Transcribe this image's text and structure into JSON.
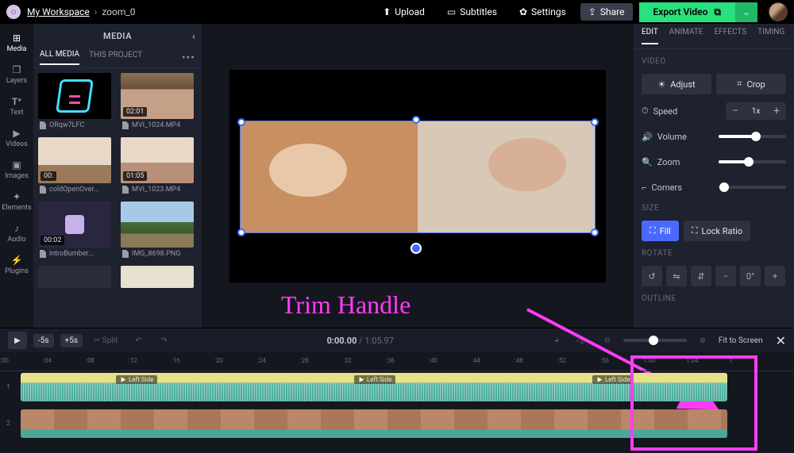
{
  "topbar": {
    "workspace": "My Workspace",
    "project": "zoom_0",
    "upload": "Upload",
    "subtitles": "Subtitles",
    "settings": "Settings",
    "share": "Share",
    "export": "Export Video"
  },
  "rail": {
    "items": [
      {
        "label": "Media"
      },
      {
        "label": "Layers"
      },
      {
        "label": "Text"
      },
      {
        "label": "Videos"
      },
      {
        "label": "Images"
      },
      {
        "label": "Elements"
      },
      {
        "label": "Audio"
      },
      {
        "label": "Plugins"
      }
    ]
  },
  "media_panel": {
    "title": "MEDIA",
    "tabs": {
      "all": "ALL MEDIA",
      "project": "THIS PROJECT"
    },
    "items": [
      {
        "name": "ORqw7LFC",
        "dur": ""
      },
      {
        "name": "MVI_1024.MP4",
        "dur": "02:01"
      },
      {
        "name": "coldOpenOver...",
        "dur": "00:"
      },
      {
        "name": "MVI_1023.MP4",
        "dur": "01:05"
      },
      {
        "name": "introBumber...",
        "dur": "00:02"
      },
      {
        "name": "IMG_8698.PNG",
        "dur": ""
      }
    ]
  },
  "annotation": "Trim Handle",
  "right_panel": {
    "tabs": {
      "edit": "EDIT",
      "animate": "ANIMATE",
      "effects": "EFFECTS",
      "timing": "TIMING"
    },
    "sections": {
      "video": "VIDEO",
      "size": "SIZE",
      "rotate": "ROTATE",
      "outline": "OUTLINE"
    },
    "adjust": "Adjust",
    "crop": "Crop",
    "speed": "Speed",
    "speed_val": "1x",
    "volume": "Volume",
    "zoom": "Zoom",
    "corners": "Corners",
    "fill": "Fill",
    "lock_ratio": "Lock Ratio"
  },
  "timeline": {
    "minus5": "-5s",
    "plus5": "+5s",
    "split": "Split",
    "current": "0:00.00",
    "duration": "1:05.97",
    "fit": "Fit to Screen",
    "seg_label": "Left Side",
    "ticks": [
      ":00",
      ":04",
      ":08",
      ":12",
      ":16",
      ":20",
      ":24",
      ":28",
      ":32",
      ":36",
      ":40",
      ":44",
      ":48",
      ":52",
      ":56",
      "1:00",
      "1:04",
      "1:"
    ]
  }
}
